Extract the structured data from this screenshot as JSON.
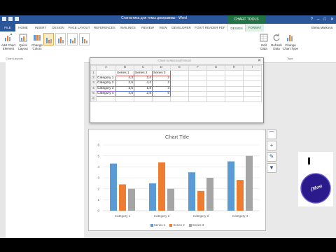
{
  "window": {
    "title": "Статистика для темы диаграммы - Word",
    "tools_title": "CHART TOOLS",
    "user": "Elena Markova"
  },
  "tabs": [
    "FILE",
    "HOME",
    "INSERT",
    "DESIGN",
    "PAGE LAYOUT",
    "REFERENCES",
    "MAILINGS",
    "REVIEW",
    "VIEW",
    "DEVELOPER",
    "FOXIT READER PDF",
    "DESIGN",
    "FORMAT"
  ],
  "ribbon": {
    "add_chart_element": "Add Chart Element",
    "quick_layout": "Quick Layout",
    "change_colors": "Change Colors",
    "group_chart_layouts": "Chart Layouts",
    "select_data": "Edit Data",
    "refresh": "Refresh Data",
    "change_chart_type": "Change Chart Type",
    "group_type": "Type"
  },
  "sheet": {
    "title": "Chart in Microsoft Word",
    "col_headers": [
      "",
      "A",
      "B",
      "C",
      "D",
      "E",
      "F",
      "G",
      "H",
      "I"
    ],
    "rows": [
      {
        "n": "1",
        "a": "",
        "b": "Series 1",
        "c": "Series 2",
        "d": "Series 3"
      },
      {
        "n": "2",
        "a": "Category 1",
        "b": "4,3",
        "c": "2,4",
        "d": "2"
      },
      {
        "n": "3",
        "a": "Category 2",
        "b": "2,5",
        "c": "4,4",
        "d": "2"
      },
      {
        "n": "4",
        "a": "Category 3",
        "b": "3,5",
        "c": "1,8",
        "d": "3"
      },
      {
        "n": "5",
        "a": "Category 4",
        "b": "4,5",
        "c": "2,8",
        "d": "5"
      },
      {
        "n": "6",
        "a": "",
        "b": "",
        "c": "",
        "d": ""
      }
    ]
  },
  "chart_data": {
    "type": "bar",
    "title": "Chart Title",
    "categories": [
      "Category 1",
      "Category 2",
      "Category 3",
      "Category 4"
    ],
    "series": [
      {
        "name": "Series 1",
        "values": [
          4.3,
          2.5,
          3.5,
          4.5
        ],
        "color": "#5b9bd5"
      },
      {
        "name": "Series 2",
        "values": [
          2.4,
          4.4,
          1.8,
          2.8
        ],
        "color": "#ed7d31"
      },
      {
        "name": "Series 3",
        "values": [
          2,
          2,
          3,
          5
        ],
        "color": "#a5a5a5"
      }
    ],
    "ylim": [
      0,
      6
    ],
    "yticks": [
      "0",
      "1",
      "2",
      "3",
      "4",
      "5",
      "6"
    ],
    "grid": true,
    "legend": "bottom"
  },
  "logo": {
    "text": "[Mast"
  }
}
